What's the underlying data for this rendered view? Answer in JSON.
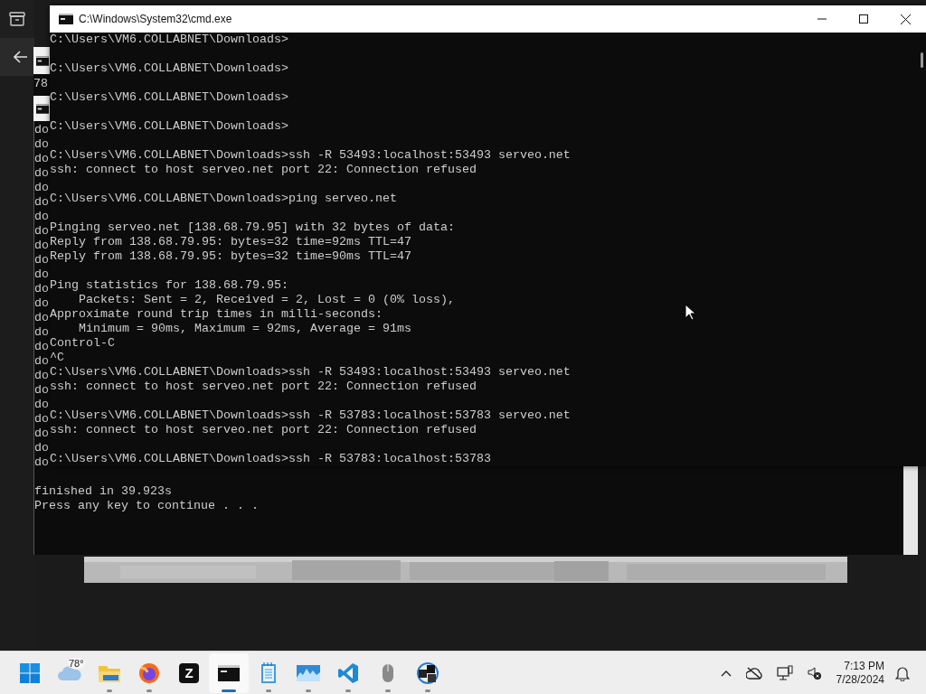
{
  "left_panel": {
    "items": [
      {
        "kind": "archive"
      },
      {
        "kind": "back"
      }
    ]
  },
  "background_window_fragment": {
    "text": "78"
  },
  "background_console": {
    "blocks": [
      [
        "do",
        "do",
        "do",
        "do",
        "do",
        "do",
        "do",
        "do",
        "do",
        "do",
        "do",
        "do",
        "do",
        "do",
        "do",
        "do",
        "do",
        "do",
        "do",
        "do",
        "do",
        "do",
        "do",
        "do"
      ],
      [
        "finished in 39.923s",
        "Press any key to continue . . ."
      ]
    ]
  },
  "window": {
    "title": "C:\\Windows\\System32\\cmd.exe",
    "blocks": [
      [
        "C:\\Users\\VM6.COLLABNET\\Downloads>"
      ],
      [
        "C:\\Users\\VM6.COLLABNET\\Downloads>"
      ],
      [
        "C:\\Users\\VM6.COLLABNET\\Downloads>"
      ],
      [
        "C:\\Users\\VM6.COLLABNET\\Downloads>"
      ],
      [
        "C:\\Users\\VM6.COLLABNET\\Downloads>ssh -R 53493:localhost:53493 serveo.net",
        "ssh: connect to host serveo.net port 22: Connection refused"
      ],
      [
        "C:\\Users\\VM6.COLLABNET\\Downloads>ping serveo.net"
      ],
      [
        "Pinging serveo.net [138.68.79.95] with 32 bytes of data:",
        "Reply from 138.68.79.95: bytes=32 time=92ms TTL=47",
        "Reply from 138.68.79.95: bytes=32 time=90ms TTL=47"
      ],
      [
        "Ping statistics for 138.68.79.95:",
        "    Packets: Sent = 2, Received = 2, Lost = 0 (0% loss),",
        "Approximate round trip times in milli-seconds:",
        "    Minimum = 90ms, Maximum = 92ms, Average = 91ms",
        "Control-C",
        "^C",
        "C:\\Users\\VM6.COLLABNET\\Downloads>ssh -R 53493:localhost:53493 serveo.net",
        "ssh: connect to host serveo.net port 22: Connection refused"
      ],
      [
        "C:\\Users\\VM6.COLLABNET\\Downloads>ssh -R 53783:localhost:53783 serveo.net",
        "ssh: connect to host serveo.net port 22: Connection refused"
      ],
      [
        "C:\\Users\\VM6.COLLABNET\\Downloads>ssh -R 53783:localhost:53783"
      ]
    ]
  },
  "taskbar": {
    "apps": [
      {
        "kind": "start",
        "running": false,
        "selected": false
      },
      {
        "kind": "weather",
        "badge": "78°",
        "running": false,
        "selected": false
      },
      {
        "kind": "folder",
        "running": true,
        "selected": false
      },
      {
        "kind": "browser",
        "running": true,
        "selected": false
      },
      {
        "kind": "letter",
        "label": "Z",
        "running": false,
        "selected": false
      },
      {
        "kind": "terminal",
        "running": true,
        "selected": true
      },
      {
        "kind": "notepad",
        "running": true,
        "selected": false
      },
      {
        "kind": "monitor",
        "running": true,
        "selected": false
      },
      {
        "kind": "code",
        "running": true,
        "selected": false
      },
      {
        "kind": "mouse",
        "running": true,
        "selected": false
      },
      {
        "kind": "cubes",
        "running": true,
        "selected": false
      }
    ],
    "tray": [
      {
        "kind": "chevron"
      },
      {
        "kind": "cloud-off"
      },
      {
        "kind": "network"
      },
      {
        "kind": "speaker-muted"
      }
    ],
    "clock": {
      "time": "7:13 PM",
      "date": "7/28/2024"
    }
  }
}
